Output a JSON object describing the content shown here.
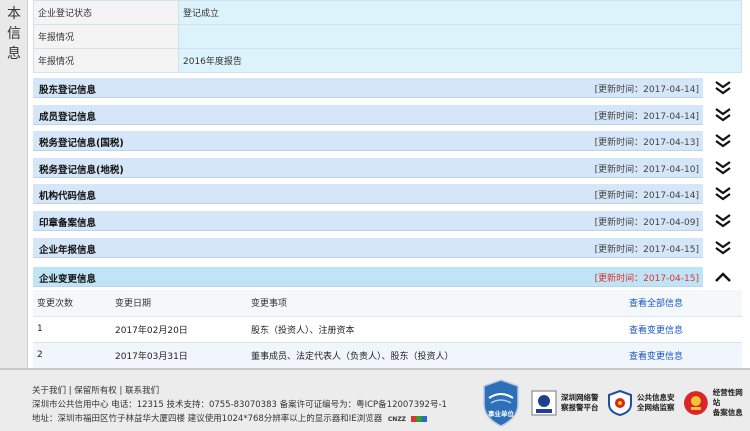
{
  "left_label": [
    "本",
    "信",
    "息"
  ],
  "info_rows": [
    {
      "key": "企业登记状态",
      "value": "登记成立"
    },
    {
      "key": "年报情况",
      "value": ""
    },
    {
      "key": "年报情况",
      "value": "2016年度报告"
    }
  ],
  "sections": [
    {
      "title": "股东登记信息",
      "time": "[更新时间：2017-04-14]",
      "state": "collapsed"
    },
    {
      "title": "成员登记信息",
      "time": "[更新时间：2017-04-14]",
      "state": "collapsed"
    },
    {
      "title": "税务登记信息(国税)",
      "time": "[更新时间：2017-04-13]",
      "state": "collapsed"
    },
    {
      "title": "税务登记信息(地税)",
      "time": "[更新时间：2017-04-10]",
      "state": "collapsed"
    },
    {
      "title": "机构代码信息",
      "time": "[更新时间：2017-04-14]",
      "state": "collapsed"
    },
    {
      "title": "印章备案信息",
      "time": "[更新时间：2017-04-09]",
      "state": "collapsed"
    },
    {
      "title": "企业年报信息",
      "time": "[更新时间：2017-04-15]",
      "state": "collapsed"
    },
    {
      "title": "企业变更信息",
      "time": "[更新时间：2017-04-15]",
      "state": "expanded"
    }
  ],
  "change_table": {
    "headers": [
      "变更次数",
      "变更日期",
      "变更事项"
    ],
    "header_link": "查看全部信息",
    "rows": [
      {
        "no": "1",
        "date": "2017年02月20日",
        "item": "股东（投资人）、注册资本",
        "link": "查看变更信息"
      },
      {
        "no": "2",
        "date": "2017年03月31日",
        "item": "董事成员、法定代表人（负责人）、股东（投资人）",
        "link": "查看变更信息"
      }
    ]
  },
  "footer": {
    "links": [
      "关于我们",
      "保留所有权",
      "联系我们"
    ],
    "line1": "深圳市公共信用中心 电话：12315 技术支持：0755-83070383 备案许可证编号为：粤ICP备12007392号-1",
    "line2": "地址：深圳市福田区竹子林益华大厦四楼 建议使用1024*768分辨率以上的显示器和IE浏览器",
    "cnzz": "CNZZ",
    "shield_label": "事业单位",
    "badges": [
      {
        "icon": "police-report-icon",
        "lines": [
          "深圳网络警",
          "察报警平台"
        ]
      },
      {
        "icon": "public-security-icon",
        "lines": [
          "公共信息安",
          "全网络监察"
        ]
      },
      {
        "icon": "business-site-icon",
        "lines": [
          "经营性网站",
          "备案信息"
        ]
      }
    ]
  },
  "colors": {
    "link": "#1a56c6",
    "highlight_time": "#e03030",
    "bar": "#d4e6f7",
    "bar_active": "#bfe4f6"
  }
}
